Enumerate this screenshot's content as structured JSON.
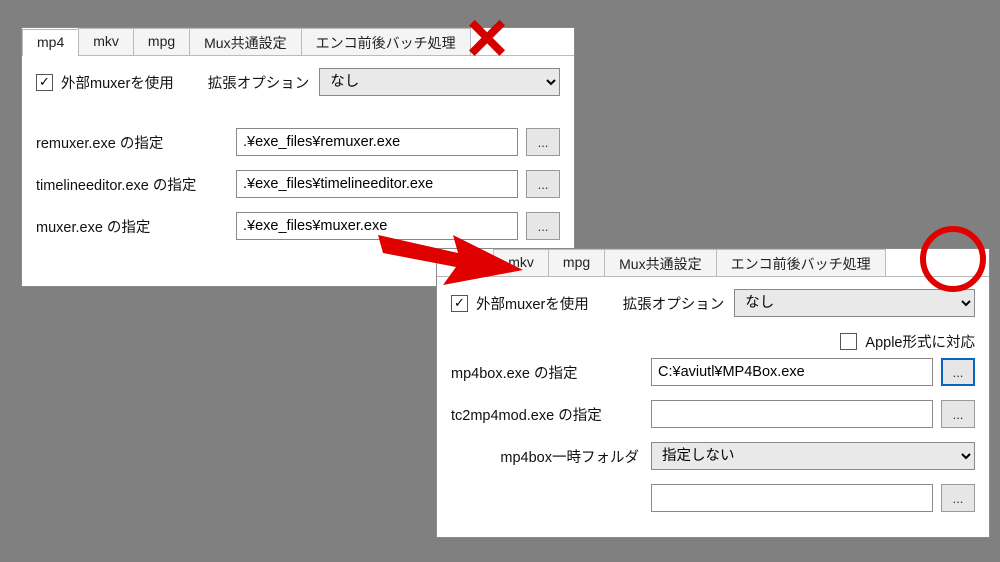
{
  "tabs": [
    "mp4",
    "mkv",
    "mpg",
    "Mux共通設定",
    "エンコ前後バッチ処理"
  ],
  "useExternalMuxer": {
    "label": "外部muxerを使用",
    "checked": true
  },
  "extOption": {
    "label": "拡張オプション",
    "value": "なし"
  },
  "panel1": {
    "activeTab": "mp4",
    "fields": [
      {
        "label": "remuxer.exe の指定",
        "value": ".¥exe_files¥remuxer.exe"
      },
      {
        "label": "timelineeditor.exe の指定",
        "value": ".¥exe_files¥timelineeditor.exe"
      },
      {
        "label": "muxer.exe の指定",
        "value": ".¥exe_files¥muxer.exe"
      }
    ]
  },
  "panel2": {
    "activeTab": "mp4",
    "apple": {
      "label": "Apple形式に対応",
      "checked": false
    },
    "tempFolder": {
      "label": "mp4box一時フォルダ",
      "value": "指定しない"
    },
    "extra": "",
    "fields": [
      {
        "label": "mp4box.exe の指定",
        "value": "C:¥aviutl¥MP4Box.exe"
      },
      {
        "label": "tc2mp4mod.exe の指定",
        "value": ""
      }
    ]
  },
  "browseLabel": "..."
}
